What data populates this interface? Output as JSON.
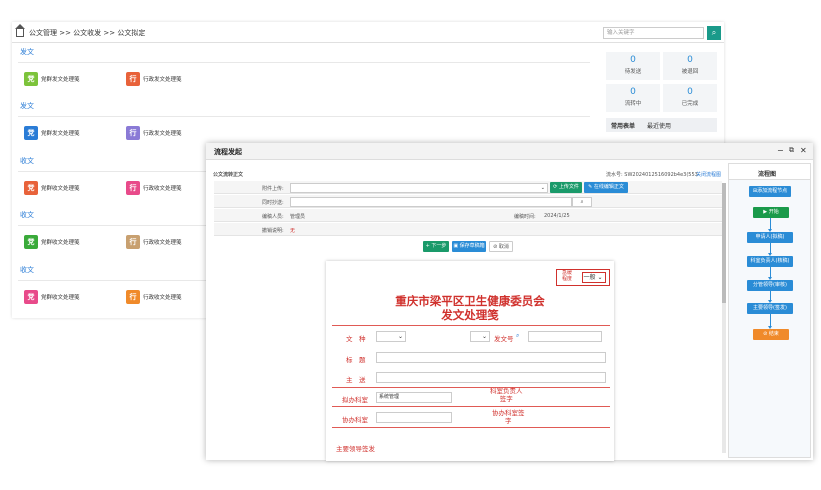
{
  "breadcrumb": {
    "text": "公文管理 >> 公文收发 >> 公文拟定"
  },
  "search": {
    "placeholder": "输入关键字"
  },
  "sections": [
    {
      "title": "发文",
      "items": [
        {
          "icon": "党",
          "label": "党群发文处理笺",
          "color": "#7cc33a"
        },
        {
          "icon": "行",
          "label": "行政发文处理笺",
          "color": "#e8623a"
        }
      ]
    },
    {
      "title": "发文",
      "items": [
        {
          "icon": "党",
          "label": "党群发文处理笺",
          "color": "#2a7cd6"
        },
        {
          "icon": "行",
          "label": "行政发文处理笺",
          "color": "#8a7ad6"
        }
      ]
    },
    {
      "title": "收文",
      "items": [
        {
          "icon": "党",
          "label": "党群收文处理笺",
          "color": "#e8623a"
        },
        {
          "icon": "行",
          "label": "行政收文处理笺",
          "color": "#e84a8a"
        }
      ]
    },
    {
      "title": "收文",
      "items": [
        {
          "icon": "党",
          "label": "党群收文处理笺",
          "color": "#3aaa3a"
        },
        {
          "icon": "行",
          "label": "行政收文处理笺",
          "color": "#c8a070"
        }
      ]
    },
    {
      "title": "收文",
      "items": [
        {
          "icon": "党",
          "label": "党群收文处理笺",
          "color": "#e84a8a"
        },
        {
          "icon": "行",
          "label": "行政收文处理笺",
          "color": "#f08a2a"
        }
      ]
    }
  ],
  "stats": [
    {
      "n": "0",
      "label": "待发送"
    },
    {
      "n": "0",
      "label": "被退回"
    },
    {
      "n": "0",
      "label": "流转中"
    },
    {
      "n": "0",
      "label": "已完成"
    }
  ],
  "tabs": {
    "active": "常用表单",
    "other": "最近使用"
  },
  "modal": {
    "title": "流程发起",
    "form_name": "公文流转正文",
    "serial_label": "流水号: SW2024012516092b4e3(553",
    "view_flow": "关闭流程图",
    "attach_label": "附件上传:",
    "upload_btn": "上传文件",
    "online_edit_btn": "在线编辑正文",
    "assoc_label": "同时抄送:",
    "editor_label": "编稿人员:",
    "editor_value": "管理员",
    "time_label": "编稿时间:",
    "time_value": "2024/1/25",
    "remark_label": "撤销说明:",
    "remark_value": "无",
    "next_btn": "下一步",
    "save_btn": "保存草稿箱",
    "cancel_btn": "取消"
  },
  "paper": {
    "urgency": "急缓\n程度",
    "level": "一般",
    "title1": "重庆市梁平区卫生健康委员会",
    "title2": "发文处理笺",
    "kind_label": "文　种",
    "docno_label": "发文号",
    "subject_label": "标　题",
    "to_label": "主　送",
    "dept_label": "拟办科室",
    "dept_value": "系统管理",
    "head_label": "科室负责人\n签字",
    "co_label": "协办科室",
    "co_head_label": "协办科室签\n字",
    "leader_label": "主要领导签发"
  },
  "flow": {
    "title": "流程图",
    "start_node": "添加流程节点",
    "nodes": [
      "开始",
      "申请人(拟稿)",
      "科室负责人(核稿)",
      "分管领导(审核)",
      "主要领导(签发)",
      "结束"
    ]
  }
}
